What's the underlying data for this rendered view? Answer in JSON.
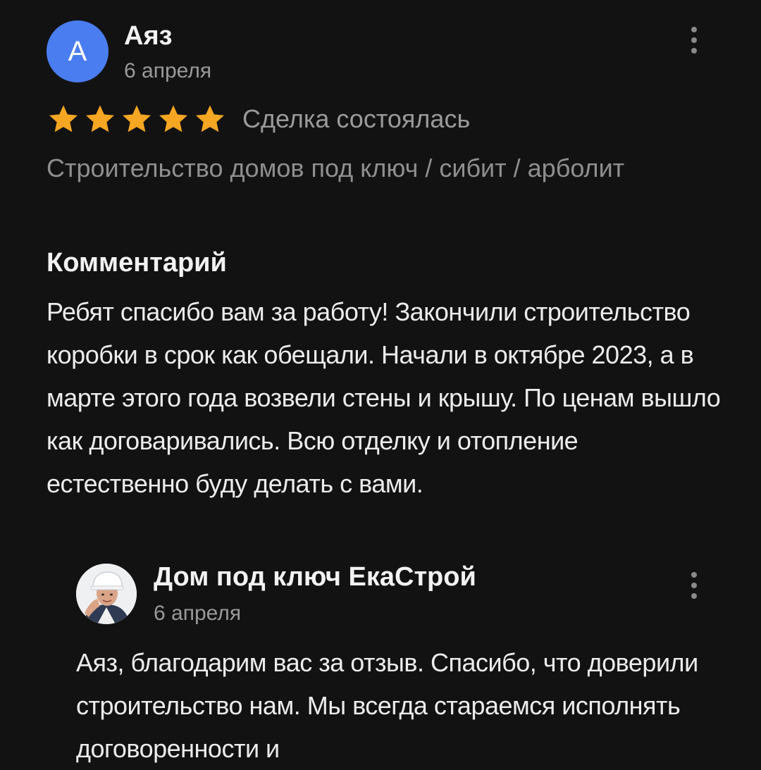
{
  "review": {
    "avatar_letter": "А",
    "author": "Аяз",
    "date": "6 апреля",
    "rating": 5,
    "rating_max": 5,
    "star_color": "#f5a623",
    "deal_status": "Сделка состоялась",
    "category": "Строительство домов под ключ / сибит / арболит",
    "comment_heading": "Комментарий",
    "comment_text": "Ребят спасибо вам за работу! Закончили строительство коробки в срок как обещали. Начали в октябре 2023, а в марте этого года возвели стены и крышу. По ценам вышло как договаривались. Всю отделку и отопление естественно буду делать с вами.",
    "menu_icon": "more-vertical-icon"
  },
  "reply": {
    "avatar_icon": "builder-portrait-avatar",
    "author": "Дом под ключ ЕкаСтрой",
    "date": "6 апреля",
    "text": "Аяз, благодарим вас за отзыв. Спасибо, что доверили строительство нам. Мы всегда стараемся исполнять договоренности и",
    "menu_icon": "more-vertical-icon"
  },
  "colors": {
    "background": "#121212",
    "avatar_blue": "#4a7df0",
    "secondary_text": "#9a9a9a"
  }
}
